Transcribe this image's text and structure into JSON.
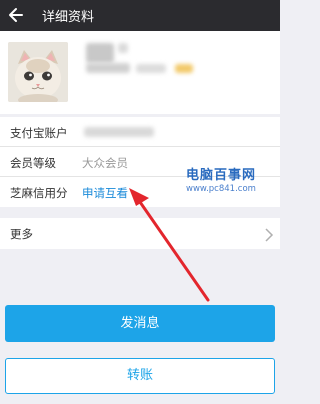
{
  "header": {
    "title": "详细资料"
  },
  "profile": {},
  "rows": [
    {
      "label": "支付宝账户",
      "value": ""
    },
    {
      "label": "会员等级",
      "value": "大众会员"
    },
    {
      "label": "芝麻信用分",
      "link": "申请互看"
    }
  ],
  "watermark": {
    "name": "电脑百事网",
    "url": "www.pc841.com"
  },
  "more": {
    "label": "更多"
  },
  "actions": {
    "send_message": "发消息",
    "transfer": "转账"
  },
  "icons": {
    "back": "back-arrow-icon",
    "more": "chevron-right-icon"
  },
  "colors": {
    "topbar": "#2b2b2f",
    "accent": "#1da4e8",
    "link": "#1a8ad9",
    "annotation": "#e3262d"
  }
}
